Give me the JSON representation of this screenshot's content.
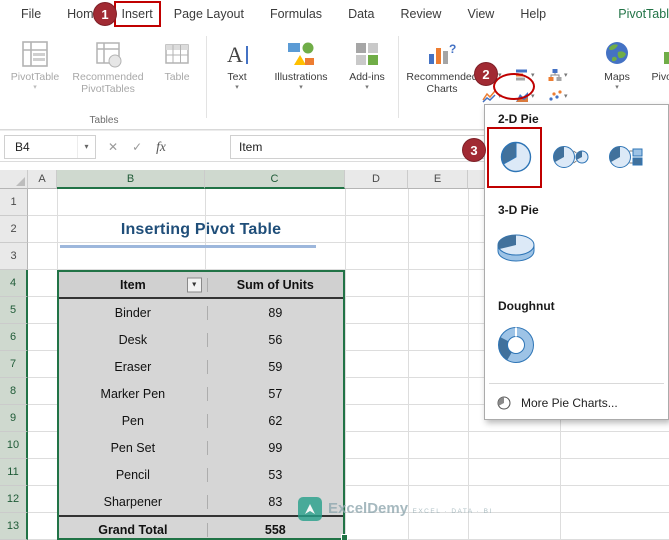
{
  "colors": {
    "excel_green": "#217346",
    "annotation_red": "#C00000",
    "title_blue": "#1F4E79"
  },
  "icons": {
    "caret_down": "▾",
    "cancel": "✕",
    "enter": "✓",
    "filter": "▼"
  },
  "menu": {
    "tabs": [
      {
        "label": "File"
      },
      {
        "label": "Home"
      },
      {
        "label": "Insert"
      },
      {
        "label": "Page Layout"
      },
      {
        "label": "Formulas"
      },
      {
        "label": "Data"
      },
      {
        "label": "Review"
      },
      {
        "label": "View"
      },
      {
        "label": "Help"
      },
      {
        "label": "PivotTabl"
      }
    ]
  },
  "ribbon": {
    "group_label": "Tables",
    "buttons": {
      "pivottable": "PivotTable",
      "recommended_pivottables": "Recommended PivotTables",
      "table": "Table",
      "text": "Text",
      "illustrations": "Illustrations",
      "addins": "Add-ins",
      "recommended_charts": "Recommended Charts",
      "maps": "Maps",
      "pivotchart": "PivotChart"
    }
  },
  "formula_bar": {
    "name_box": "B4",
    "fx": "fx",
    "content": "Item"
  },
  "annotations": {
    "step1": "1",
    "step2": "2",
    "step3": "3"
  },
  "chart_menu": {
    "section_2d": "2-D Pie",
    "section_3d": "3-D Pie",
    "section_doughnut": "Doughnut",
    "more": "More Pie Charts..."
  },
  "sheet": {
    "columns": [
      "A",
      "B",
      "C",
      "D",
      "E"
    ],
    "rows": [
      "1",
      "2",
      "3",
      "4",
      "5",
      "6",
      "7",
      "8",
      "9",
      "10",
      "11",
      "12",
      "13"
    ],
    "title": "Inserting Pivot Table",
    "table": {
      "headers": [
        "Item",
        "Sum of Units"
      ],
      "data": [
        [
          "Binder",
          "89"
        ],
        [
          "Desk",
          "56"
        ],
        [
          "Eraser",
          "59"
        ],
        [
          "Marker Pen",
          "57"
        ],
        [
          "Pen",
          "62"
        ],
        [
          "Pen Set",
          "99"
        ],
        [
          "Pencil",
          "53"
        ],
        [
          "Sharpener",
          "83"
        ]
      ],
      "total_label": "Grand Total",
      "total_value": "558"
    }
  },
  "watermark": {
    "brand": "ExcelDemy",
    "tagline": "EXCEL · DATA · BI"
  }
}
